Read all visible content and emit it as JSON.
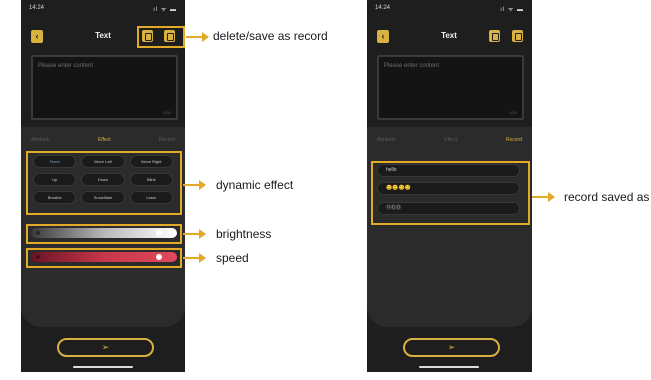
{
  "status_bar": {
    "time": "14:24",
    "system": "ıl ᯤ ▬"
  },
  "header": {
    "title": "Text",
    "back_icon": "chevron-left-icon"
  },
  "input": {
    "placeholder": "Please enter content",
    "count": "0/50"
  },
  "tabs": [
    "Attribute",
    "Effect",
    "Record"
  ],
  "effects": [
    "Fixed",
    "Move Left",
    "Move Right",
    "Up",
    "Down",
    "Blink",
    "Breathe",
    "Snowflake",
    "Laser"
  ],
  "sliders": {
    "brightness": 0.92,
    "speed": 0.92
  },
  "records": [
    "hello",
    "😊😊😊😊",
    "⑪⑫⑬"
  ],
  "send_icon": "paper-plane-icon",
  "annotations": {
    "header_buttons": "delete/save as record",
    "effects": "dynamic effect",
    "brightness": "brightness",
    "speed": "speed",
    "records": "record saved as"
  },
  "colors": {
    "accent": "#d8b240",
    "highlight": "#e3a928",
    "background": "#1e1e1e"
  }
}
